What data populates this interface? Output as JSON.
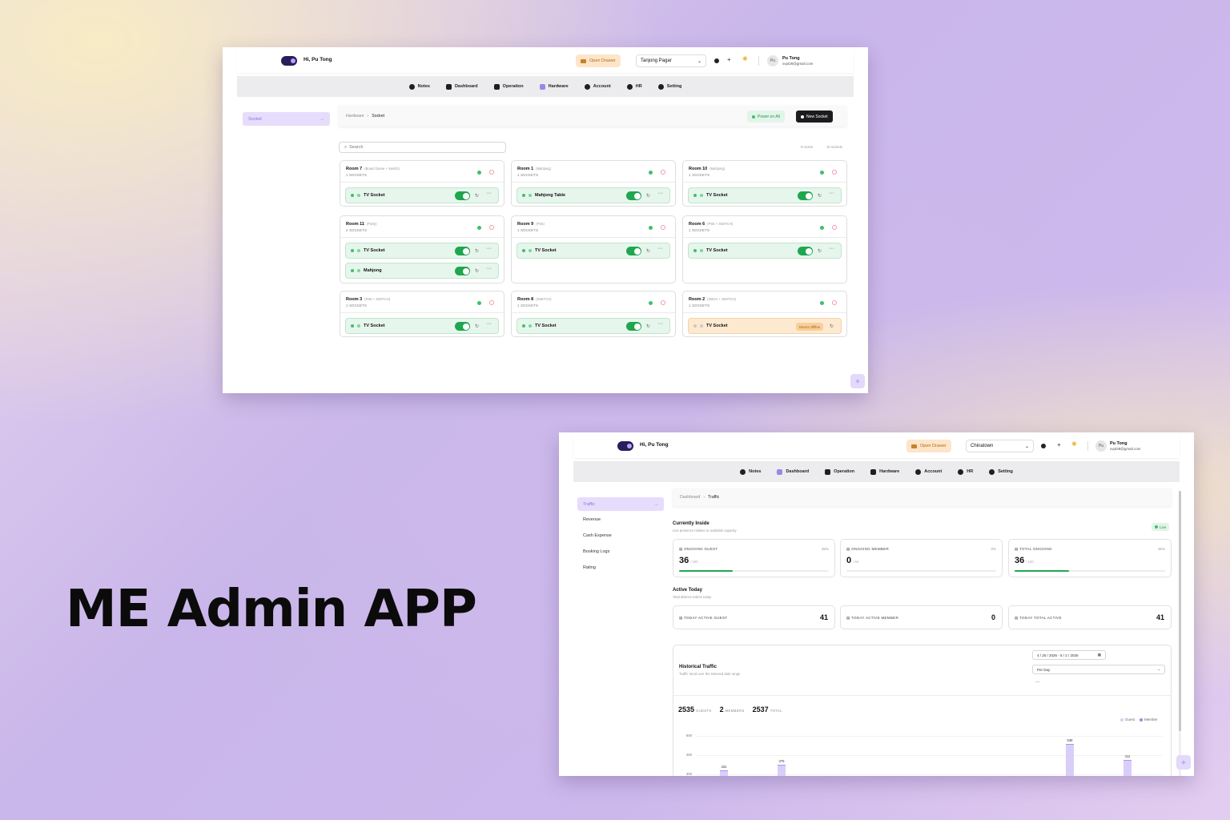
{
  "hero": {
    "title": "ME Admin APP"
  },
  "nav": [
    "Notes",
    "Dashboard",
    "Operation",
    "Hardware",
    "Account",
    "HR",
    "Setting"
  ],
  "icons": {
    "nav": [
      "info-icon",
      "dashboard-icon",
      "rocket-icon",
      "cube-icon",
      "user-icon",
      "hr-icon",
      "gear-icon"
    ],
    "fab": "sparkle-icon"
  },
  "colors": {
    "accent": "#9c86e6",
    "success": "#1fa64f",
    "warning": "#f8cf9a"
  },
  "app1": {
    "greeting": "Hi, Pu Tong",
    "drawer": "Open Drawer",
    "branch": "Tanjong Pagar",
    "avatar": "Pu",
    "user_name": "Pu Tong",
    "user_email": "xvpt28@gmail.com",
    "sidebar": {
      "active": "Socket"
    },
    "breadcrumb": {
      "parent": "Hardware",
      "current": "Socket"
    },
    "power_all": "Power on All",
    "new_socket": "New Socket",
    "search_placeholder": "Search",
    "rooms_count": "9 rooms",
    "sockets_count": "10 sockets",
    "rooms": [
      {
        "name": "Room 7",
        "tag": "(Board Game + Switch)",
        "count": "1 SOCKETS",
        "sockets": [
          {
            "name": "TV Socket",
            "status": "on"
          }
        ]
      },
      {
        "name": "Room 1",
        "tag": "(Mahjong)",
        "count": "1 SOCKETS",
        "sockets": [
          {
            "name": "Mahjong Table",
            "status": "on"
          }
        ]
      },
      {
        "name": "Room 10",
        "tag": "(Mahjong)",
        "count": "1 SOCKETS",
        "sockets": [
          {
            "name": "TV Socket",
            "status": "on"
          }
        ]
      },
      {
        "name": "Room 11",
        "tag": "(Party)",
        "count": "2 SOCKETS",
        "sockets": [
          {
            "name": "TV Socket",
            "status": "on"
          },
          {
            "name": "Mahjong",
            "status": "on"
          }
        ]
      },
      {
        "name": "Room 9",
        "tag": "(PS5)",
        "count": "1 SOCKETS",
        "sockets": [
          {
            "name": "TV Socket",
            "status": "on"
          }
        ]
      },
      {
        "name": "Room 6",
        "tag": "(PS5 + SWITCH)",
        "count": "1 SOCKETS",
        "sockets": [
          {
            "name": "TV Socket",
            "status": "on"
          }
        ]
      },
      {
        "name": "Room 3",
        "tag": "(PS5 + SWITCH)",
        "count": "1 SOCKETS",
        "sockets": [
          {
            "name": "TV Socket",
            "status": "on"
          }
        ]
      },
      {
        "name": "Room 8",
        "tag": "(SWITCH)",
        "count": "1 SOCKETS",
        "sockets": [
          {
            "name": "TV Socket",
            "status": "on"
          }
        ]
      },
      {
        "name": "Room 2",
        "tag": "(XBOX + SWITCH)",
        "count": "1 SOCKETS",
        "sockets": [
          {
            "name": "TV Socket",
            "status": "offline",
            "badge": "Device Offline"
          }
        ]
      }
    ]
  },
  "app2": {
    "greeting": "Hi, Pu Tong",
    "drawer": "Open Drawer",
    "branch": "Chinatown",
    "avatar": "Pu",
    "user_name": "Pu Tong",
    "user_email": "xvpt28@gmail.com",
    "sidebar": [
      "Traffic",
      "Revenue",
      "Cash Expense",
      "Booking Logs",
      "Rating"
    ],
    "breadcrumb": {
      "parent": "Dashboard",
      "current": "Traffic"
    },
    "inside": {
      "title": "Currently Inside",
      "subtitle": "Live presence relative to available capacity",
      "live": "Live",
      "cards": [
        {
          "label": "ONGOING GUEST",
          "pct": "36%",
          "value": "36",
          "cap": "/ 100",
          "fill": 0.36
        },
        {
          "label": "ONGOING MEMBER",
          "pct": "0%",
          "value": "0",
          "cap": "/ 64",
          "fill": 0
        },
        {
          "label": "TOTAL ONGOING",
          "pct": "36%",
          "value": "36",
          "cap": "/ 100",
          "fill": 0.36
        }
      ]
    },
    "active": {
      "title": "Active Today",
      "subtitle": "Total distinct entries today",
      "cards": [
        {
          "label": "TODAY ACTIVE GUEST",
          "value": "41"
        },
        {
          "label": "TODAY ACTIVE MEMBER",
          "value": "0"
        },
        {
          "label": "TODAY TOTAL ACTIVE",
          "value": "41"
        }
      ]
    },
    "history": {
      "title": "Historical Traffic",
      "subtitle": "Traffic trend over the selected date range",
      "date_range": "4 / 25 / 2026 - 5 / 2 / 2026",
      "granularity": "Per Day",
      "more": "...",
      "guests": "2535",
      "guests_label": "GUESTS",
      "members": "2",
      "members_label": "MEMBERS",
      "total": "2537",
      "total_label": "TOTAL",
      "legend_guest": "Guest",
      "legend_member": "Member"
    }
  },
  "chart_data": {
    "type": "bar",
    "title": "Historical Traffic",
    "series": [
      {
        "name": "Guest",
        "values": [
          331,
          375,
          0,
          0,
          0,
          0,
          538,
          411
        ]
      },
      {
        "name": "Member",
        "values": []
      }
    ],
    "yticks": [
      300,
      450,
      600
    ],
    "ylim": [
      300,
      600
    ],
    "data_labels": [
      "331",
      "375",
      "538",
      "411"
    ]
  }
}
